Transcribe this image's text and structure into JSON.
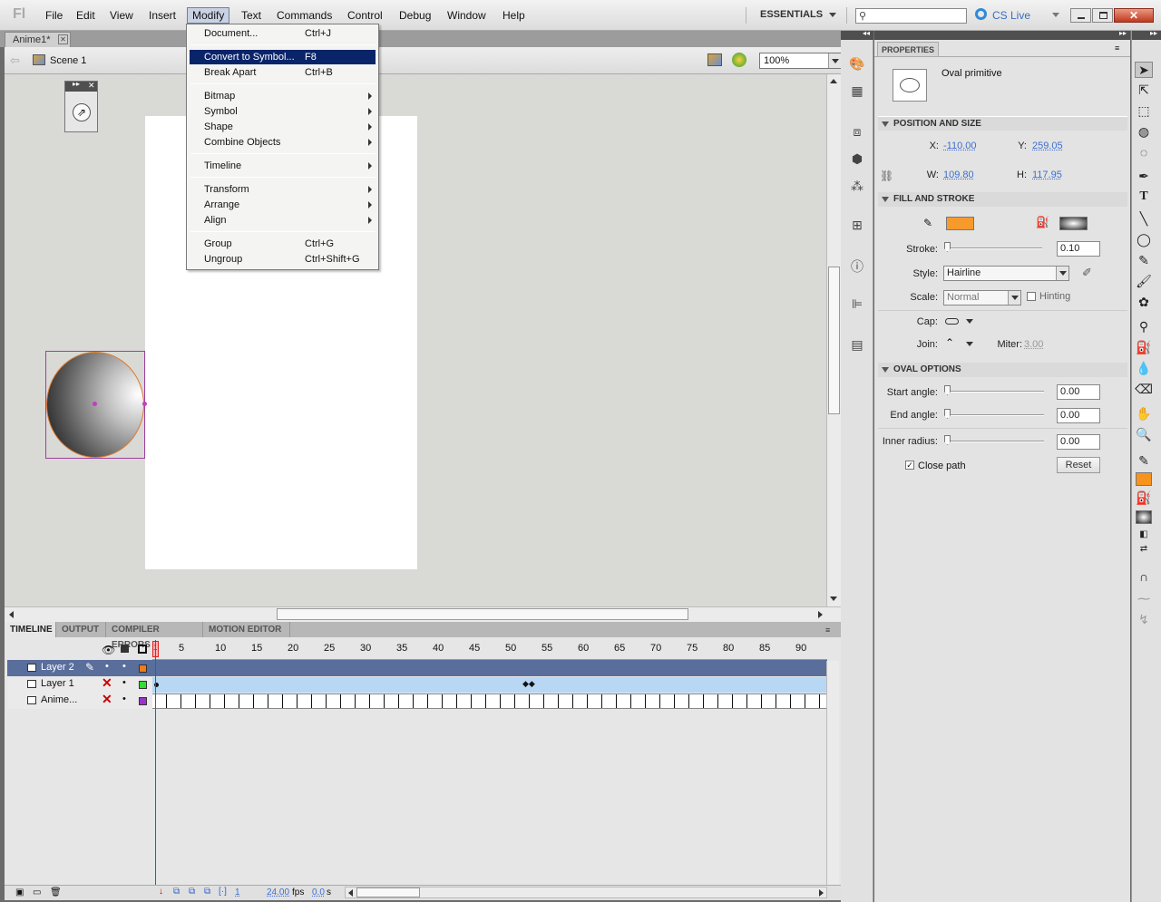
{
  "app": {
    "logo": "Fl"
  },
  "menubar": {
    "items": [
      "File",
      "Edit",
      "View",
      "Insert",
      "Modify",
      "Text",
      "Commands",
      "Control",
      "Debug",
      "Window",
      "Help"
    ],
    "active": "Modify",
    "workspace": "ESSENTIALS",
    "cs_live": "CS Live"
  },
  "document": {
    "tab": "Anime1*",
    "scene": "Scene 1",
    "zoom": "100%"
  },
  "modify_menu": [
    {
      "label": "Document...",
      "shortcut": "Ctrl+J"
    },
    {
      "label": "Convert to Symbol...",
      "shortcut": "F8",
      "highlighted": true
    },
    {
      "label": "Break Apart",
      "shortcut": "Ctrl+B"
    },
    {
      "label": "Bitmap",
      "submenu": true
    },
    {
      "label": "Symbol",
      "submenu": true
    },
    {
      "label": "Shape",
      "submenu": true
    },
    {
      "label": "Combine Objects",
      "submenu": true
    },
    {
      "label": "Timeline",
      "submenu": true
    },
    {
      "label": "Transform",
      "submenu": true
    },
    {
      "label": "Arrange",
      "submenu": true
    },
    {
      "label": "Align",
      "submenu": true
    },
    {
      "label": "Group",
      "shortcut": "Ctrl+G"
    },
    {
      "label": "Ungroup",
      "shortcut": "Ctrl+Shift+G"
    }
  ],
  "timeline": {
    "tabs": [
      "TIMELINE",
      "OUTPUT",
      "COMPILER ERRORS",
      "MOTION EDITOR"
    ],
    "ruler": [
      "5",
      "10",
      "15",
      "20",
      "25",
      "30",
      "35",
      "40",
      "45",
      "50",
      "55",
      "60",
      "65",
      "70",
      "75",
      "80",
      "85",
      "90"
    ],
    "playhead": "1",
    "layers": [
      {
        "name": "Layer 2",
        "color": "#f07c1a",
        "selected": true
      },
      {
        "name": "Layer 1",
        "color": "#33dd33"
      },
      {
        "name": "Anime...",
        "color": "#9933cc"
      }
    ],
    "status": {
      "frame": "1",
      "fps": "24.00",
      "fps_unit": "fps",
      "time": "0.0",
      "time_unit": "s"
    }
  },
  "properties": {
    "title": "PROPERTIES",
    "object_type": "Oval primitive",
    "position_size": {
      "header": "POSITION AND SIZE",
      "x_label": "X:",
      "x": "-110.00",
      "y_label": "Y:",
      "y": "259.05",
      "w_label": "W:",
      "w": "109.80",
      "h_label": "H:",
      "h": "117.95"
    },
    "fill_stroke": {
      "header": "FILL AND STROKE",
      "stroke_color": "#f79a2e",
      "stroke_label": "Stroke:",
      "stroke_value": "0.10",
      "style_label": "Style:",
      "style": "Hairline",
      "scale_label": "Scale:",
      "scale": "Normal",
      "hinting": "Hinting",
      "cap_label": "Cap:",
      "join_label": "Join:",
      "miter_label": "Miter:",
      "miter": "3.00"
    },
    "oval_options": {
      "header": "OVAL OPTIONS",
      "start_label": "Start angle:",
      "start": "0.00",
      "end_label": "End angle:",
      "end": "0.00",
      "inner_label": "Inner radius:",
      "inner": "0.00",
      "close_path": "Close path",
      "reset": "Reset"
    }
  },
  "colors": {
    "fill_swatch": "#f7941d"
  }
}
